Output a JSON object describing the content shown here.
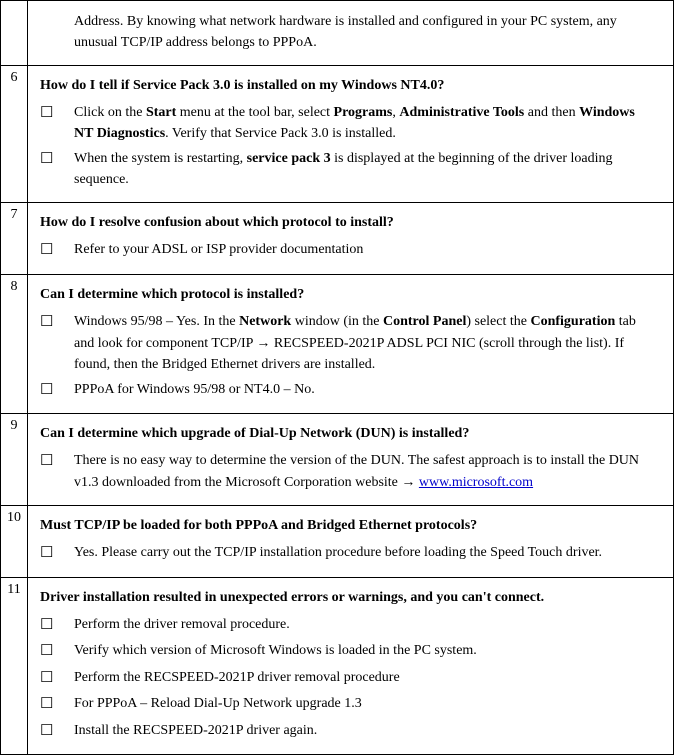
{
  "rows": [
    {
      "num": "",
      "question": "",
      "items": [
        {
          "html": "Address. By knowing what network hardware is installed and configured in your PC system, any unusual TCP/IP address belongs to PPPoA.",
          "indentOnly": true
        }
      ]
    },
    {
      "num": "6",
      "question": "How do I tell if Service Pack 3.0 is installed on my Windows NT4.0?",
      "items": [
        {
          "html": "Click on the <span class='b'>Start</span> menu at the tool bar, select <span class='b'>Programs</span>, <span class='b'>Administrative Tools</span> and then <span class='b'>Windows NT Diagnostics</span>. Verify that Service Pack 3.0 is installed."
        },
        {
          "html": "When the system is restarting, <span class='b'>service pack 3</span> is displayed at the beginning of the driver loading sequence."
        }
      ]
    },
    {
      "num": "7",
      "question": "How do I resolve confusion about which protocol to install?",
      "items": [
        {
          "html": "Refer to your ADSL or ISP provider documentation"
        }
      ]
    },
    {
      "num": "8",
      "question": "Can I determine which protocol is installed?",
      "items": [
        {
          "html": "Windows 95/98 – Yes. In the <span class='b'>Network</span> window (in the <span class='b'>Control Panel</span>) select the <span class='b'>Configuration</span> tab and look for component TCP/IP <span class='arrow'>&#8594;</span> RECSPEED-2021P ADSL PCI NIC (scroll through the list). If found, then the Bridged Ethernet drivers are installed."
        },
        {
          "html": "PPPoA for Windows 95/98 or NT4.0 – No."
        }
      ]
    },
    {
      "num": "9",
      "question": "Can I determine which upgrade of Dial-Up Network (DUN) is installed?",
      "items": [
        {
          "html": "There is no easy way to determine the version of the DUN. The safest approach is to install the DUN v1.3 downloaded from the Microsoft Corporation website <span class='arrow'>&#8594;</span> <a href='#' data-name='microsoft-link' data-interactable='true'>www.microsoft.com</a>"
        }
      ]
    },
    {
      "num": "10",
      "question": "Must TCP/IP be loaded for both PPPoA and Bridged Ethernet protocols?",
      "items": [
        {
          "html": "Yes. Please carry out the TCP/IP installation procedure before loading the Speed Touch driver."
        }
      ]
    },
    {
      "num": "11",
      "question": "Driver installation resulted in unexpected errors or warnings, and you can't connect.",
      "items": [
        {
          "html": "Perform the driver removal procedure."
        },
        {
          "html": "Verify which version of Microsoft Windows is loaded in the PC system."
        },
        {
          "html": "Perform the RECSPEED-2021P driver removal procedure"
        },
        {
          "html": "For PPPoA – Reload Dial-Up Network upgrade 1.3"
        },
        {
          "html": "Install the RECSPEED-2021P driver again."
        }
      ]
    }
  ],
  "checkbox_glyph": "☐"
}
